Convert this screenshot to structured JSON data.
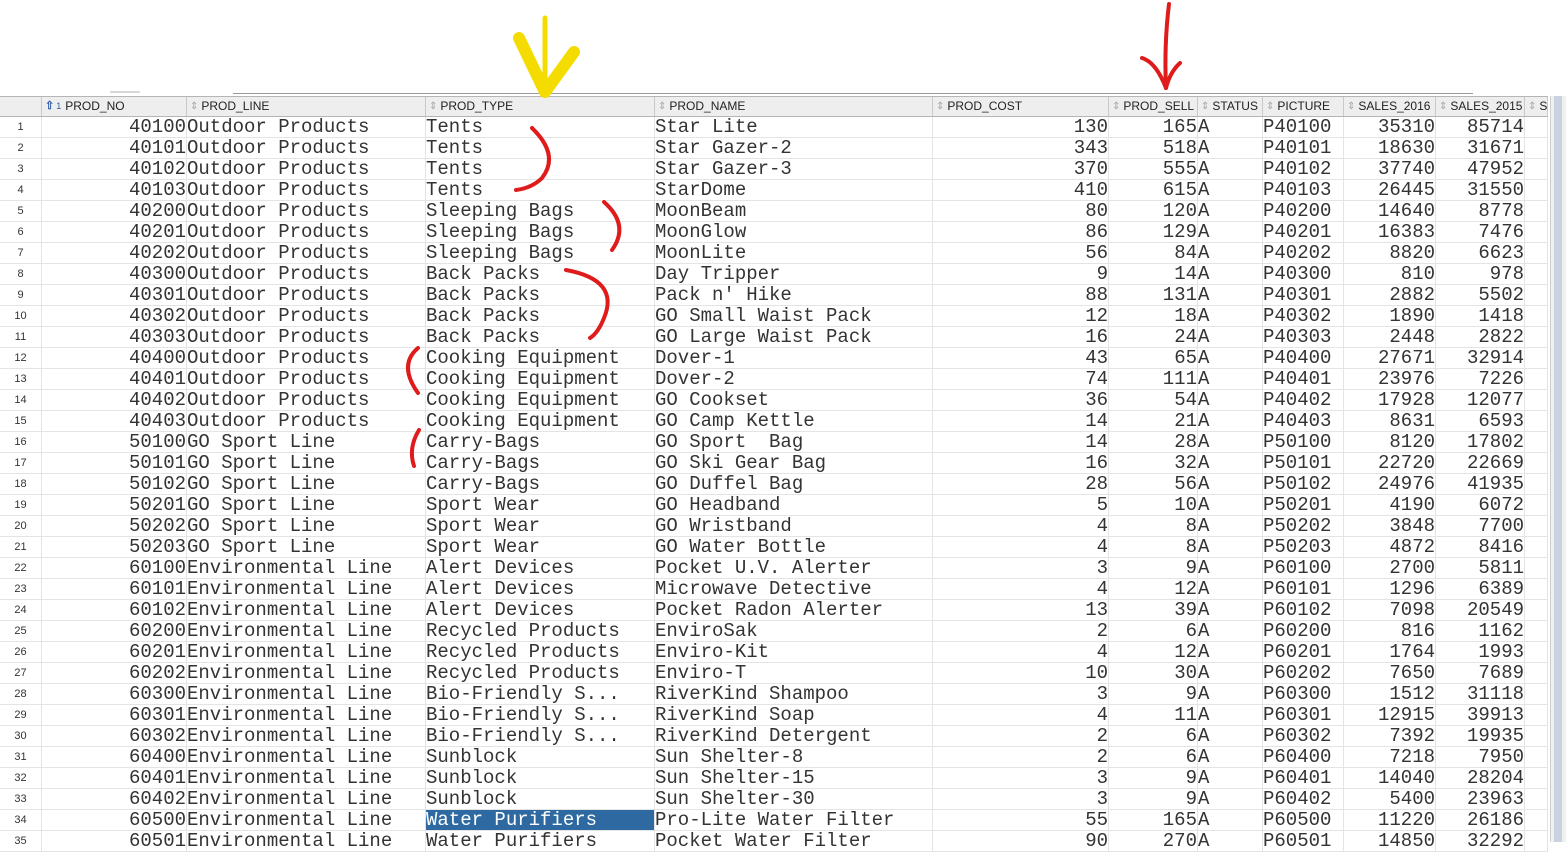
{
  "columns": [
    {
      "key": "rownum",
      "label": ""
    },
    {
      "key": "prod_no",
      "label": "PROD_NO",
      "sorted": "asc",
      "sort_order": "1"
    },
    {
      "key": "prod_line",
      "label": "PROD_LINE"
    },
    {
      "key": "prod_type",
      "label": "PROD_TYPE"
    },
    {
      "key": "prod_name",
      "label": "PROD_NAME"
    },
    {
      "key": "prod_cost",
      "label": "PROD_COST"
    },
    {
      "key": "prod_sell",
      "label": "PROD_SELL"
    },
    {
      "key": "status",
      "label": "STATUS"
    },
    {
      "key": "picture",
      "label": "PICTURE"
    },
    {
      "key": "sales_2016",
      "label": "SALES_2016"
    },
    {
      "key": "sales_2015",
      "label": "SALES_2015"
    },
    {
      "key": "more",
      "label": "S"
    }
  ],
  "icons": {
    "sort": "⇕",
    "sort_asc": "⇧"
  },
  "selected_cell": {
    "row": 34,
    "column": "prod_type"
  },
  "colors": {
    "selection": "#2e6aa1",
    "annotation_yellow": "#f5dc00",
    "annotation_red": "#e01b1b"
  },
  "rows": [
    [
      "1",
      "40100",
      "Outdoor Products",
      "Tents",
      "Star Lite",
      "130",
      "165",
      "A",
      "P40100",
      "35310",
      "85714"
    ],
    [
      "2",
      "40101",
      "Outdoor Products",
      "Tents",
      "Star Gazer-2",
      "343",
      "518",
      "A",
      "P40101",
      "18630",
      "31671"
    ],
    [
      "3",
      "40102",
      "Outdoor Products",
      "Tents",
      "Star Gazer-3",
      "370",
      "555",
      "A",
      "P40102",
      "37740",
      "47952"
    ],
    [
      "4",
      "40103",
      "Outdoor Products",
      "Tents",
      "StarDome",
      "410",
      "615",
      "A",
      "P40103",
      "26445",
      "31550"
    ],
    [
      "5",
      "40200",
      "Outdoor Products",
      "Sleeping Bags",
      "MoonBeam",
      "80",
      "120",
      "A",
      "P40200",
      "14640",
      "8778"
    ],
    [
      "6",
      "40201",
      "Outdoor Products",
      "Sleeping Bags",
      "MoonGlow",
      "86",
      "129",
      "A",
      "P40201",
      "16383",
      "7476"
    ],
    [
      "7",
      "40202",
      "Outdoor Products",
      "Sleeping Bags",
      "MoonLite",
      "56",
      "84",
      "A",
      "P40202",
      "8820",
      "6623"
    ],
    [
      "8",
      "40300",
      "Outdoor Products",
      "Back Packs",
      "Day Tripper",
      "9",
      "14",
      "A",
      "P40300",
      "810",
      "978"
    ],
    [
      "9",
      "40301",
      "Outdoor Products",
      "Back Packs",
      "Pack n' Hike",
      "88",
      "131",
      "A",
      "P40301",
      "2882",
      "5502"
    ],
    [
      "10",
      "40302",
      "Outdoor Products",
      "Back Packs",
      "GO Small Waist Pack",
      "12",
      "18",
      "A",
      "P40302",
      "1890",
      "1418"
    ],
    [
      "11",
      "40303",
      "Outdoor Products",
      "Back Packs",
      "GO Large Waist Pack",
      "16",
      "24",
      "A",
      "P40303",
      "2448",
      "2822"
    ],
    [
      "12",
      "40400",
      "Outdoor Products",
      "Cooking Equipment",
      "Dover-1",
      "43",
      "65",
      "A",
      "P40400",
      "27671",
      "32914"
    ],
    [
      "13",
      "40401",
      "Outdoor Products",
      "Cooking Equipment",
      "Dover-2",
      "74",
      "111",
      "A",
      "P40401",
      "23976",
      "7226"
    ],
    [
      "14",
      "40402",
      "Outdoor Products",
      "Cooking Equipment",
      "GO Cookset",
      "36",
      "54",
      "A",
      "P40402",
      "17928",
      "12077"
    ],
    [
      "15",
      "40403",
      "Outdoor Products",
      "Cooking Equipment",
      "GO Camp Kettle",
      "14",
      "21",
      "A",
      "P40403",
      "8631",
      "6593"
    ],
    [
      "16",
      "50100",
      "GO Sport Line",
      "Carry-Bags",
      "GO Sport  Bag",
      "14",
      "28",
      "A",
      "P50100",
      "8120",
      "17802"
    ],
    [
      "17",
      "50101",
      "GO Sport Line",
      "Carry-Bags",
      "GO Ski Gear Bag",
      "16",
      "32",
      "A",
      "P50101",
      "22720",
      "22669"
    ],
    [
      "18",
      "50102",
      "GO Sport Line",
      "Carry-Bags",
      "GO Duffel Bag",
      "28",
      "56",
      "A",
      "P50102",
      "24976",
      "41935"
    ],
    [
      "19",
      "50201",
      "GO Sport Line",
      "Sport Wear",
      "GO Headband",
      "5",
      "10",
      "A",
      "P50201",
      "4190",
      "6072"
    ],
    [
      "20",
      "50202",
      "GO Sport Line",
      "Sport Wear",
      "GO Wristband",
      "4",
      "8",
      "A",
      "P50202",
      "3848",
      "7700"
    ],
    [
      "21",
      "50203",
      "GO Sport Line",
      "Sport Wear",
      "GO Water Bottle",
      "4",
      "8",
      "A",
      "P50203",
      "4872",
      "8416"
    ],
    [
      "22",
      "60100",
      "Environmental Line",
      "Alert Devices",
      "Pocket U.V. Alerter",
      "3",
      "9",
      "A",
      "P60100",
      "2700",
      "5811"
    ],
    [
      "23",
      "60101",
      "Environmental Line",
      "Alert Devices",
      "Microwave Detective",
      "4",
      "12",
      "A",
      "P60101",
      "1296",
      "6389"
    ],
    [
      "24",
      "60102",
      "Environmental Line",
      "Alert Devices",
      "Pocket Radon Alerter",
      "13",
      "39",
      "A",
      "P60102",
      "7098",
      "20549"
    ],
    [
      "25",
      "60200",
      "Environmental Line",
      "Recycled Products",
      "EnviroSak",
      "2",
      "6",
      "A",
      "P60200",
      "816",
      "1162"
    ],
    [
      "26",
      "60201",
      "Environmental Line",
      "Recycled Products",
      "Enviro-Kit",
      "4",
      "12",
      "A",
      "P60201",
      "1764",
      "1993"
    ],
    [
      "27",
      "60202",
      "Environmental Line",
      "Recycled Products",
      "Enviro-T",
      "10",
      "30",
      "A",
      "P60202",
      "7650",
      "7689"
    ],
    [
      "28",
      "60300",
      "Environmental Line",
      "Bio-Friendly S...",
      "RiverKind Shampoo",
      "3",
      "9",
      "A",
      "P60300",
      "1512",
      "31118"
    ],
    [
      "29",
      "60301",
      "Environmental Line",
      "Bio-Friendly S...",
      "RiverKind Soap",
      "4",
      "11",
      "A",
      "P60301",
      "12915",
      "39913"
    ],
    [
      "30",
      "60302",
      "Environmental Line",
      "Bio-Friendly S...",
      "RiverKind Detergent",
      "2",
      "6",
      "A",
      "P60302",
      "7392",
      "19935"
    ],
    [
      "31",
      "60400",
      "Environmental Line",
      "Sunblock",
      "Sun Shelter-8",
      "2",
      "6",
      "A",
      "P60400",
      "7218",
      "7950"
    ],
    [
      "32",
      "60401",
      "Environmental Line",
      "Sunblock",
      "Sun Shelter-15",
      "3",
      "9",
      "A",
      "P60401",
      "14040",
      "28204"
    ],
    [
      "33",
      "60402",
      "Environmental Line",
      "Sunblock",
      "Sun Shelter-30",
      "3",
      "9",
      "A",
      "P60402",
      "5400",
      "23963"
    ],
    [
      "34",
      "60500",
      "Environmental Line",
      "Water Purifiers",
      "Pro-Lite Water Filter",
      "55",
      "165",
      "A",
      "P60500",
      "11220",
      "26186"
    ],
    [
      "35",
      "60501",
      "Environmental Line",
      "Water Purifiers",
      "Pocket Water Filter",
      "90",
      "270",
      "A",
      "P60501",
      "14850",
      "32292"
    ]
  ]
}
